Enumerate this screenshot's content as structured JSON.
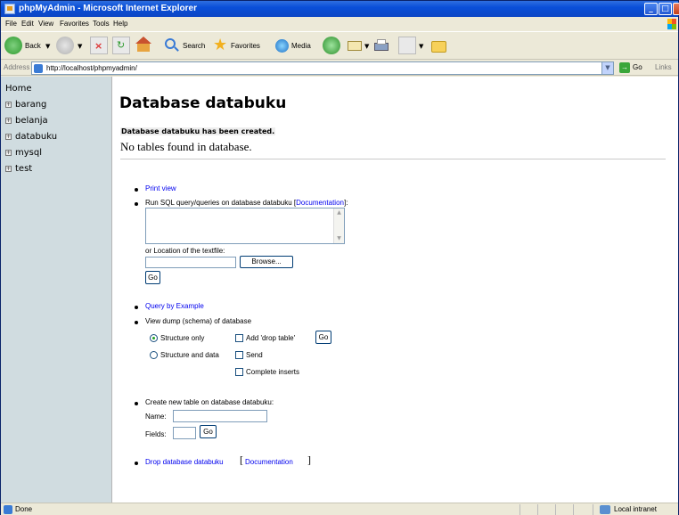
{
  "window": {
    "title": "phpMyAdmin - Microsoft Internet Explorer",
    "min": "_",
    "max": "□",
    "close": "x"
  },
  "menu": [
    "File",
    "Edit",
    "View",
    "Favorites",
    "Tools",
    "Help"
  ],
  "toolbar": {
    "back": "Back",
    "search": "Search",
    "favorites": "Favorites",
    "media": "Media"
  },
  "address": {
    "label": "Address",
    "url": "http://localhost/phpmyadmin/",
    "go": "Go",
    "links": "Links"
  },
  "nav": {
    "home": "Home",
    "databases": [
      "barang",
      "belanja",
      "databuku",
      "mysql",
      "test"
    ]
  },
  "main": {
    "title": "Database databuku",
    "created_msg": "Database databuku has been created.",
    "no_tables": "No tables found in database.",
    "print_view": "Print view",
    "run_sql": "Run SQL query/queries on database databuku [",
    "documentation": "Documentation",
    "run_sql_end": "]:",
    "location_label": "or Location of the textfile:",
    "browse": "Browse...",
    "go": "Go",
    "query_by_example": "Query by Example",
    "view_dump": "View dump (schema) of database",
    "structure_only": "Structure only",
    "structure_and_data": "Structure and data",
    "add_drop_table": "Add 'drop table'",
    "send": "Send",
    "complete_inserts": "Complete inserts",
    "create_table": "Create new table on database databuku:",
    "name_label": "Name:",
    "fields_label": "Fields:",
    "drop_db": "Drop database databuku",
    "structure_only_selected": true
  },
  "status": {
    "text": "Done",
    "zone": "Local intranet"
  }
}
